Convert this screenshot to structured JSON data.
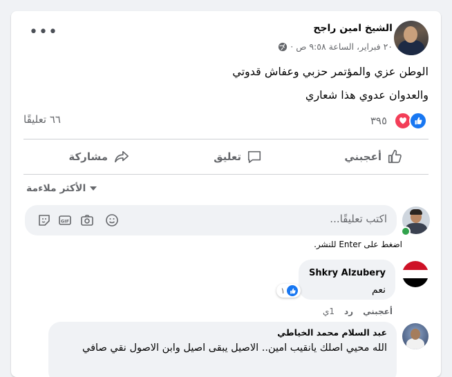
{
  "post": {
    "author": "الشيخ امين راجح",
    "meta": "٢٠ فبراير، الساعة ٩:٥٨ ص ·",
    "lines": [
      "الوطن عزي والمؤتمر حزبي وعفاش قدوتي",
      "والعدوان عدوي هذا شعاري"
    ],
    "reactions_count": "٣٩٥",
    "comments_count": "٦٦ تعليقًا"
  },
  "actions": {
    "like": "أعجبني",
    "comment": "تعليق",
    "share": "مشاركة"
  },
  "sort_label": "الأكثر ملاءمة",
  "composer": {
    "placeholder": "اكتب تعليقًا...",
    "hint": "اضغط على Enter للنشر."
  },
  "comments": [
    {
      "author": "Shkry Alzubery",
      "text": "نعم",
      "reaction_count": "١",
      "like_label": "أعجبني",
      "reply_label": "رد",
      "time": "1ي"
    },
    {
      "author": "عبد السلام محمد الخياطي",
      "text": "الله محيي اصلك يانقيب امين.. الاصيل يبقى اصيل وابن الاصول نقي صافي"
    }
  ],
  "colors": {
    "like_blue": "#1877f2",
    "love_red": "#f33e58",
    "flag": [
      "#ce1126",
      "#ffffff",
      "#000000"
    ]
  }
}
